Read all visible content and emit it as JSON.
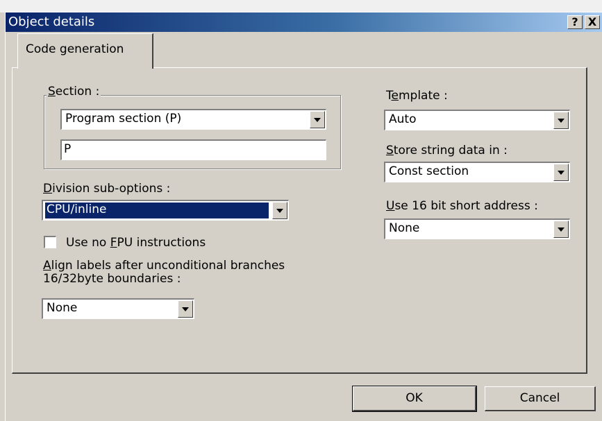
{
  "window": {
    "title": "Object details",
    "help_label": "?",
    "close_label": "X"
  },
  "tabs": [
    {
      "label": "Code generation",
      "active": true
    }
  ],
  "section": {
    "label": "Section :",
    "mnemonic": "S",
    "selected": "Program section (P)",
    "name_value": "P"
  },
  "division": {
    "label": "Division sub-options :",
    "mnemonic": "D",
    "selected": "CPU/inline"
  },
  "no_fpu": {
    "label": "Use no FPU instructions",
    "mnemonic": "F",
    "checked": false
  },
  "align": {
    "label_line1": "Align labels after unconditional branches",
    "label_line2": "16/32byte boundaries :",
    "mnemonic": "A",
    "selected": "None"
  },
  "template": {
    "label": "Template :",
    "mnemonic": "e",
    "selected": "Auto"
  },
  "store_string": {
    "label": "Store string data in :",
    "mnemonic": "S",
    "selected": "Const section"
  },
  "short_address": {
    "label": "Use 16 bit short address :",
    "mnemonic": "U",
    "selected": "None"
  },
  "buttons": {
    "ok": "OK",
    "cancel": "Cancel"
  },
  "colors": {
    "dialog_bg": "#d4d0c8",
    "title_active": "#0a246a",
    "selection": "#0a246a"
  }
}
